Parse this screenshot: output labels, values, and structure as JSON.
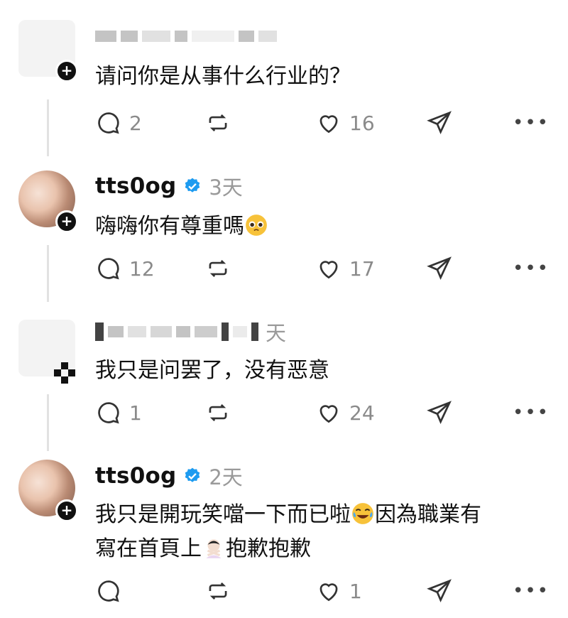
{
  "posts": [
    {
      "author": "",
      "time": "",
      "body": "请问你是从事什么行业的？",
      "replies": "2",
      "likes": "16",
      "avatar": "blurred"
    },
    {
      "author": "tts0og",
      "time": "3天",
      "body_a": "嗨嗨你有尊重嗎",
      "body_emoji": "pleading-face",
      "replies": "12",
      "likes": "17",
      "avatar": "photo"
    },
    {
      "author": "",
      "time": "天",
      "body": "我只是问罢了，没有恶意",
      "replies": "1",
      "likes": "24",
      "avatar": "blurred"
    },
    {
      "author": "tts0og",
      "time": "2天",
      "body_line1_a": "我只是開玩笑噹一下而已啦",
      "body_line1_b": "因為職業有",
      "body_line2_a": "寫在首頁上",
      "body_line2_b": "抱歉抱歉",
      "emoji_1": "face-with-tears-of-joy",
      "emoji_2": "person-gesturing-no",
      "replies": "",
      "likes": "1",
      "avatar": "photo"
    }
  ],
  "icons": {
    "comment": "comment-icon",
    "repost": "repost-icon",
    "like": "heart-icon",
    "share": "share-icon",
    "more": "more-icon"
  },
  "more_label": "•••",
  "colors": {
    "verified": "#1d9bf0",
    "muted": "#8a8a8a"
  }
}
